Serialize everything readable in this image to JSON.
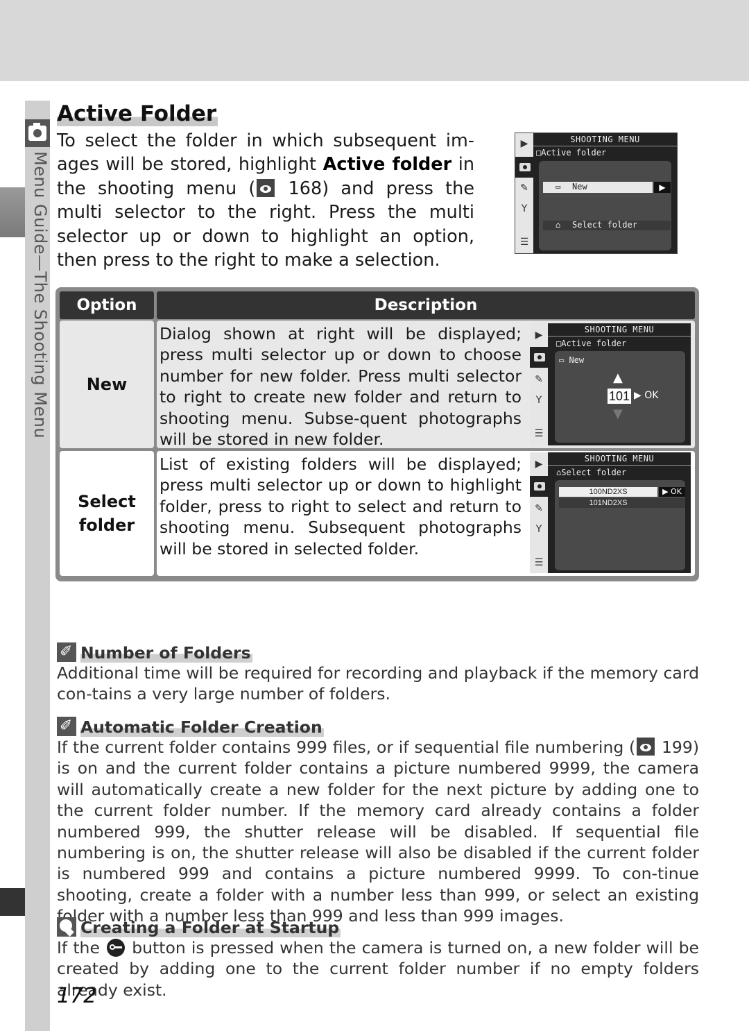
{
  "side": {
    "section_label": "Menu Guide—The Shooting Menu"
  },
  "title": "Active Folder",
  "intro": {
    "part1": "To select the folder in which subsequent im-ages will be stored, highlight ",
    "bold": "Active folder",
    "part2": " in the shooting menu (",
    "ref_page": "168",
    "part3": ") and press the multi selector to the right.  Press the multi selector up or down to highlight an option, then press to the right to make a selection."
  },
  "lcd_main": {
    "header": "SHOOTING MENU",
    "subtitle": "Active folder",
    "items": [
      {
        "label": "New",
        "selected": true,
        "arrow": "▶"
      },
      {
        "label": "Select folder",
        "selected": false
      }
    ]
  },
  "table": {
    "headers": [
      "Option",
      "Description"
    ],
    "rows": [
      {
        "option": "New",
        "description": "Dialog shown at right will be displayed; press multi selector up or down to choose number for new folder.  Press multi selector to right to create new folder and return to shooting menu.  Subse-quent photographs will be stored in new folder.",
        "lcd": {
          "header": "SHOOTING MENU",
          "subtitle": "Active folder",
          "item": "New",
          "up": "▲",
          "number": "101",
          "ok": "▶ OK",
          "down": "▼"
        }
      },
      {
        "option": "Select folder",
        "description": "List of existing folders will be displayed; press multi selector up or down to highlight folder, press to right to select and return to shooting menu.  Subsequent photographs will be stored in selected folder.",
        "lcd": {
          "header": "SHOOTING MENU",
          "subtitle": "Select folder",
          "folders": [
            "100ND2XS",
            "101ND2XS"
          ],
          "ok": "▶ OK"
        }
      }
    ]
  },
  "notes": [
    {
      "icon": "paperclip-icon",
      "title": "Number of Folders",
      "body": "Additional time will be required for recording and playback if the memory card con-tains a very large number of folders."
    },
    {
      "icon": "paperclip-icon",
      "title": "Automatic Folder Creation",
      "body_part1": "If the current folder contains 999 files, or if sequential file numbering (",
      "ref_page": "199",
      "body_part2": ") is on and the current folder contains a picture numbered 9999, the camera will automatically create a new folder for the next picture by adding one to the current folder number.  If the memory card already contains a folder numbered 999, the shutter release will be disabled.  If sequential file numbering is on, the shutter release will also be disabled if the current folder is numbered 999 and contains a picture numbered 9999.   To con-tinue shooting, create a folder with a number less than 999, or select an existing folder with a number less than 999 and less than 999 images."
    },
    {
      "icon": "lightbulb-icon",
      "title": "Creating a Folder at Startup",
      "body_part1": "If the ",
      "body_part2": " button is pressed when the camera is turned on, a new folder will be created by adding one to the current folder number if no empty folders already exist."
    }
  ],
  "page_number": "172"
}
